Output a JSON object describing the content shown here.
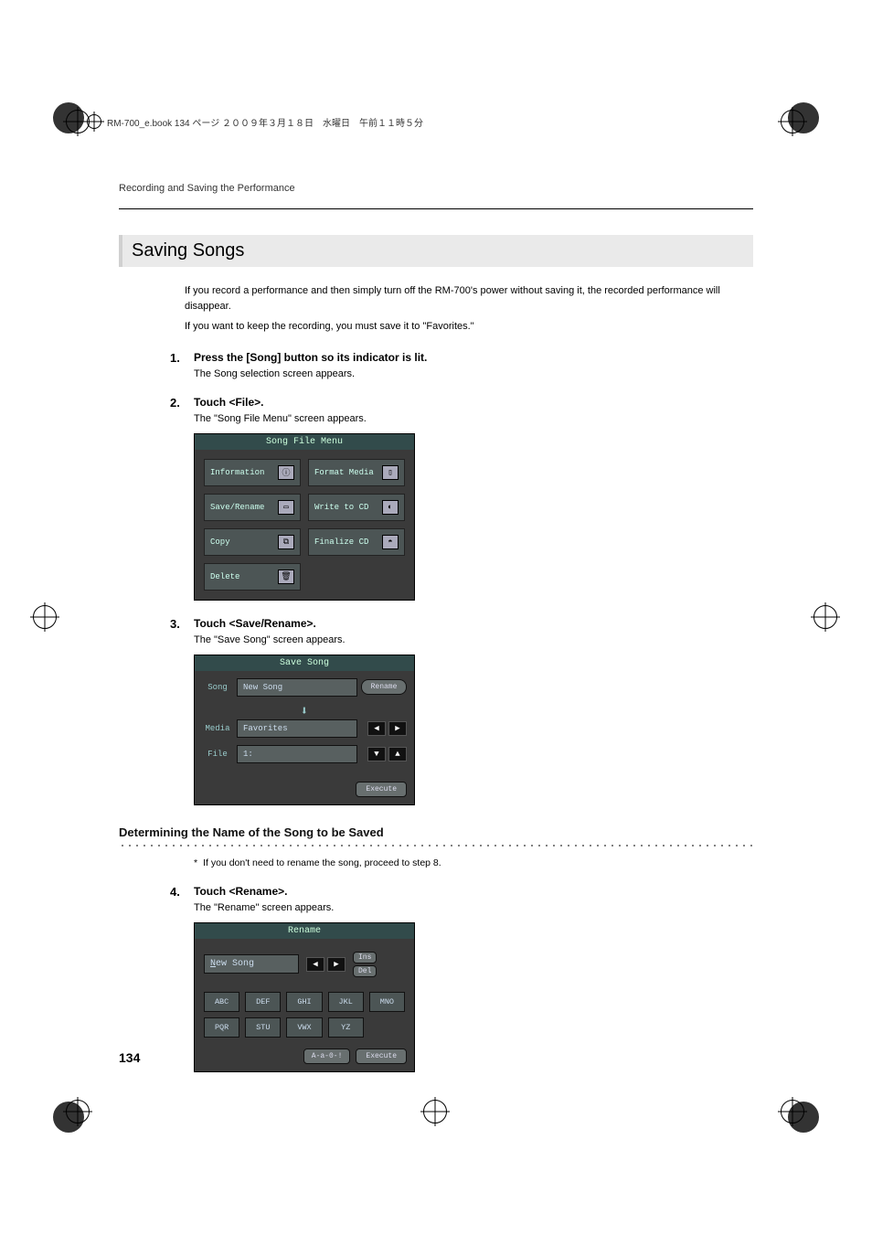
{
  "header": {
    "book_info": "RM-700_e.book  134 ページ  ２００９年３月１８日　水曜日　午前１１時５分"
  },
  "running_head": "Recording and Saving the Performance",
  "section_title": "Saving Songs",
  "intro": {
    "line1": "If you record a performance and then simply turn off the RM-700's power without saving it, the recorded performance will disappear.",
    "line2": "If you want to keep the recording, you must save it to \"Favorites.\""
  },
  "steps": {
    "s1": {
      "num": "1.",
      "title": "Press the [Song] button so its indicator is lit.",
      "body": "The Song selection screen appears."
    },
    "s2": {
      "num": "2.",
      "title": "Touch <File>.",
      "body": "The \"Song File Menu\" screen appears."
    },
    "s3": {
      "num": "3.",
      "title": "Touch <Save/Rename>.",
      "body": "The \"Save Song\" screen appears."
    },
    "s4": {
      "num": "4.",
      "title": "Touch <Rename>.",
      "body": "The \"Rename\" screen appears."
    }
  },
  "subsection": {
    "title": "Determining the Name of the Song to be Saved",
    "note_marker": "*",
    "note": "If you don't need to rename the song, proceed to step 8."
  },
  "panels": {
    "song_file_menu": {
      "title": "Song File Menu",
      "items": [
        {
          "label": "Information",
          "icon": "ⓘ"
        },
        {
          "label": "Format Media",
          "icon": "▯"
        },
        {
          "label": "Save/Rename",
          "icon": "▭"
        },
        {
          "label": "Write to CD",
          "icon": "◐"
        },
        {
          "label": "Copy",
          "icon": "⧉"
        },
        {
          "label": "Finalize CD",
          "icon": "◓"
        },
        {
          "label": "Delete",
          "icon": "🗑"
        }
      ]
    },
    "save_song": {
      "title": "Save Song",
      "rows": {
        "song": {
          "label": "Song",
          "value": "New Song",
          "action": "Rename"
        },
        "media": {
          "label": "Media",
          "value": "Favorites"
        },
        "file": {
          "label": "File",
          "value": "1:"
        }
      },
      "execute": "Execute"
    },
    "rename": {
      "title": "Rename",
      "field": "New Song",
      "ins": "Ins",
      "del": "Del",
      "keys": [
        "ABC",
        "DEF",
        "GHI",
        "JKL",
        "MNO",
        "PQR",
        "STU",
        "VWX",
        "YZ"
      ],
      "mode": "A-a-0-!",
      "execute": "Execute"
    }
  },
  "page_number": "134"
}
